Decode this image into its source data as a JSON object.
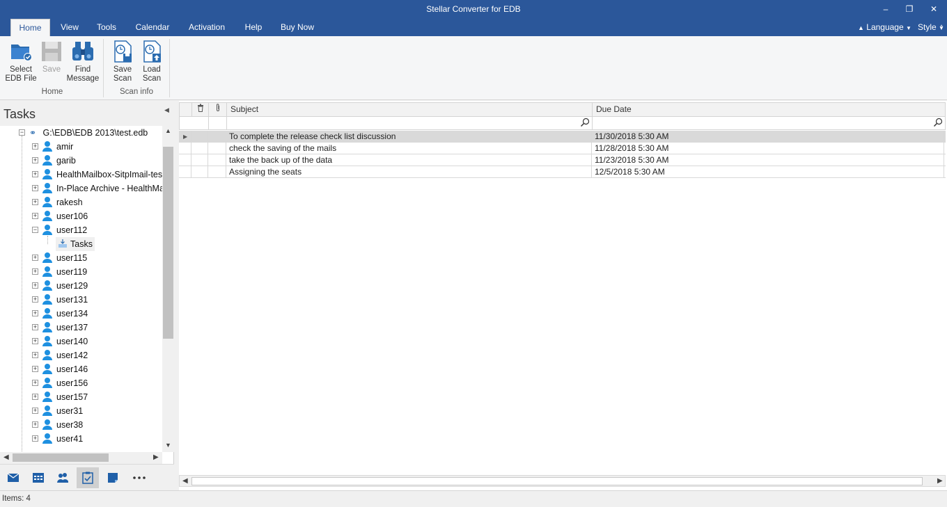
{
  "app": {
    "title": "Stellar Converter for EDB"
  },
  "window_controls": {
    "minimize": "‒",
    "restore": "❐",
    "close": "✕"
  },
  "menu": {
    "tabs": [
      "Home",
      "View",
      "Tools",
      "Calendar",
      "Activation",
      "Help",
      "Buy Now"
    ],
    "active_tab": "Home",
    "right": {
      "language": "Language",
      "style": "Style"
    }
  },
  "ribbon": {
    "buttons": [
      {
        "line1": "Select",
        "line2": "EDB File",
        "icon": "folder-check-icon",
        "enabled": true
      },
      {
        "line1": "Save",
        "line2": "",
        "icon": "save-icon",
        "enabled": false
      },
      {
        "line1": "Find",
        "line2": "Message",
        "icon": "binoculars-icon",
        "enabled": true
      },
      {
        "line1": "Save",
        "line2": "Scan",
        "icon": "save-scan-icon",
        "enabled": true
      },
      {
        "line1": "Load",
        "line2": "Scan",
        "icon": "load-scan-icon",
        "enabled": true
      }
    ],
    "groups": [
      "Home",
      "Scan info"
    ]
  },
  "left_pane": {
    "title": "Tasks",
    "root": "G:\\EDB\\EDB 2013\\test.edb",
    "users": [
      "amir",
      "garib",
      "HealthMailbox-SitpImail-test",
      "In-Place Archive - HealthMa",
      "rakesh",
      "user106",
      "user112",
      "user115",
      "user119",
      "user129",
      "user131",
      "user134",
      "user137",
      "user140",
      "user142",
      "user146",
      "user156",
      "user157",
      "user31",
      "user38",
      "user41"
    ],
    "expanded_user": "user112",
    "child_folder": "Tasks"
  },
  "nav_icons": [
    "mail-icon",
    "calendar-icon",
    "contacts-icon",
    "tasks-icon",
    "notes-icon",
    "more-icon"
  ],
  "grid": {
    "columns": {
      "subject": "Subject",
      "due_date": "Due Date"
    },
    "rows": [
      {
        "subject": "To complete the release check list discussion",
        "due": "11/30/2018 5:30 AM"
      },
      {
        "subject": "check the saving of the mails",
        "due": "11/28/2018 5:30 AM"
      },
      {
        "subject": "take the back up of the data",
        "due": "11/23/2018 5:30 AM"
      },
      {
        "subject": "Assigning the seats",
        "due": "12/5/2018 5:30 AM"
      }
    ]
  },
  "status": {
    "items": "Items: 4"
  },
  "colors": {
    "accent": "#2b579a",
    "user_icon": "#1e90e0"
  }
}
